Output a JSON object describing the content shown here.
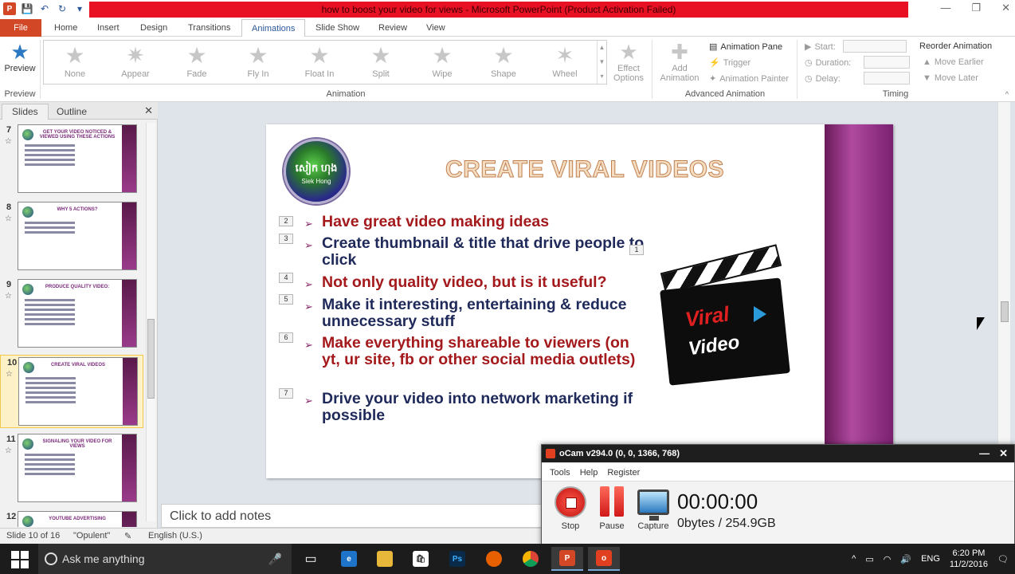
{
  "window": {
    "title": "how to boost your video for views  -  Microsoft PowerPoint (Product Activation Failed)"
  },
  "tabs": [
    {
      "label": "File"
    },
    {
      "label": "Home"
    },
    {
      "label": "Insert"
    },
    {
      "label": "Design"
    },
    {
      "label": "Transitions"
    },
    {
      "label": "Animations"
    },
    {
      "label": "Slide Show"
    },
    {
      "label": "Review"
    },
    {
      "label": "View"
    }
  ],
  "ribbon": {
    "preview": {
      "label": "Preview",
      "group": "Preview"
    },
    "animation_group": "Animation",
    "gallery": [
      "None",
      "Appear",
      "Fade",
      "Fly In",
      "Float In",
      "Split",
      "Wipe",
      "Shape",
      "Wheel"
    ],
    "effect_options": "Effect Options",
    "add_animation": "Add Animation",
    "animation_pane": "Animation Pane",
    "trigger": "Trigger",
    "animation_painter": "Animation Painter",
    "advanced_group": "Advanced Animation",
    "start_label": "Start:",
    "duration_label": "Duration:",
    "delay_label": "Delay:",
    "reorder": "Reorder Animation",
    "move_earlier": "Move Earlier",
    "move_later": "Move Later",
    "timing_group": "Timing"
  },
  "left_pane": {
    "tabs": [
      "Slides",
      "Outline"
    ],
    "thumbs": [
      {
        "num": "7",
        "title": "GET YOUR VIDEO NOTICED & VIEWED USING THESE ACTIONS"
      },
      {
        "num": "8",
        "title": "WHY 5 ACTIONS?"
      },
      {
        "num": "9",
        "title": "PRODUCE QUALITY VIDEO:"
      },
      {
        "num": "10",
        "title": "CREATE VIRAL VIDEOS"
      },
      {
        "num": "11",
        "title": "SIGNALING YOUR VIDEO FOR VIEWS"
      },
      {
        "num": "12",
        "title": "YOUTUBE ADVERTISING"
      }
    ]
  },
  "slide": {
    "title": "CREATE VIRAL VIDEOS",
    "logo_text_1": "សៀក ហុង",
    "logo_text_2": "Siek Hong",
    "bullets": [
      {
        "num": "2",
        "text": "Have great video making ideas",
        "color": "#a3191c"
      },
      {
        "num": "3",
        "text": "Create thumbnail & title that drive people to click",
        "color": "#1f2a5a"
      },
      {
        "num": "4",
        "text": "Not only quality video, but is it useful?",
        "color": "#a3191c"
      },
      {
        "num": "5",
        "text": "Make it interesting, entertaining & reduce unnecessary stuff",
        "color": "#1f2a5a"
      },
      {
        "num": "6",
        "text": "Make everything shareable to viewers (on yt, ur site, fb or other social media outlets)",
        "color": "#a3191c"
      },
      {
        "num": "7",
        "text": "Drive your video into network marketing if possible",
        "color": "#1f2a5a"
      }
    ],
    "image_marker": "1",
    "clapper_text_1": "Viral",
    "clapper_text_2": "Video"
  },
  "notes": {
    "placeholder": "Click to add notes"
  },
  "status": {
    "slide": "Slide 10 of 16",
    "theme": "\"Opulent\"",
    "language": "English (U.S.)"
  },
  "ocam": {
    "title": "oCam v294.0 (0, 0, 1366, 768)",
    "menu": [
      "Tools",
      "Help",
      "Register"
    ],
    "stop": "Stop",
    "pause": "Pause",
    "capture": "Capture",
    "time": "00:00:00",
    "size": "0bytes / 254.9GB"
  },
  "taskbar": {
    "search_placeholder": "Ask me anything",
    "language": "ENG",
    "time": "6:20 PM",
    "date": "11/2/2016"
  },
  "colors": {
    "accent": "#d24726",
    "title_error": "#e81123",
    "band": "#9a3a8a"
  }
}
